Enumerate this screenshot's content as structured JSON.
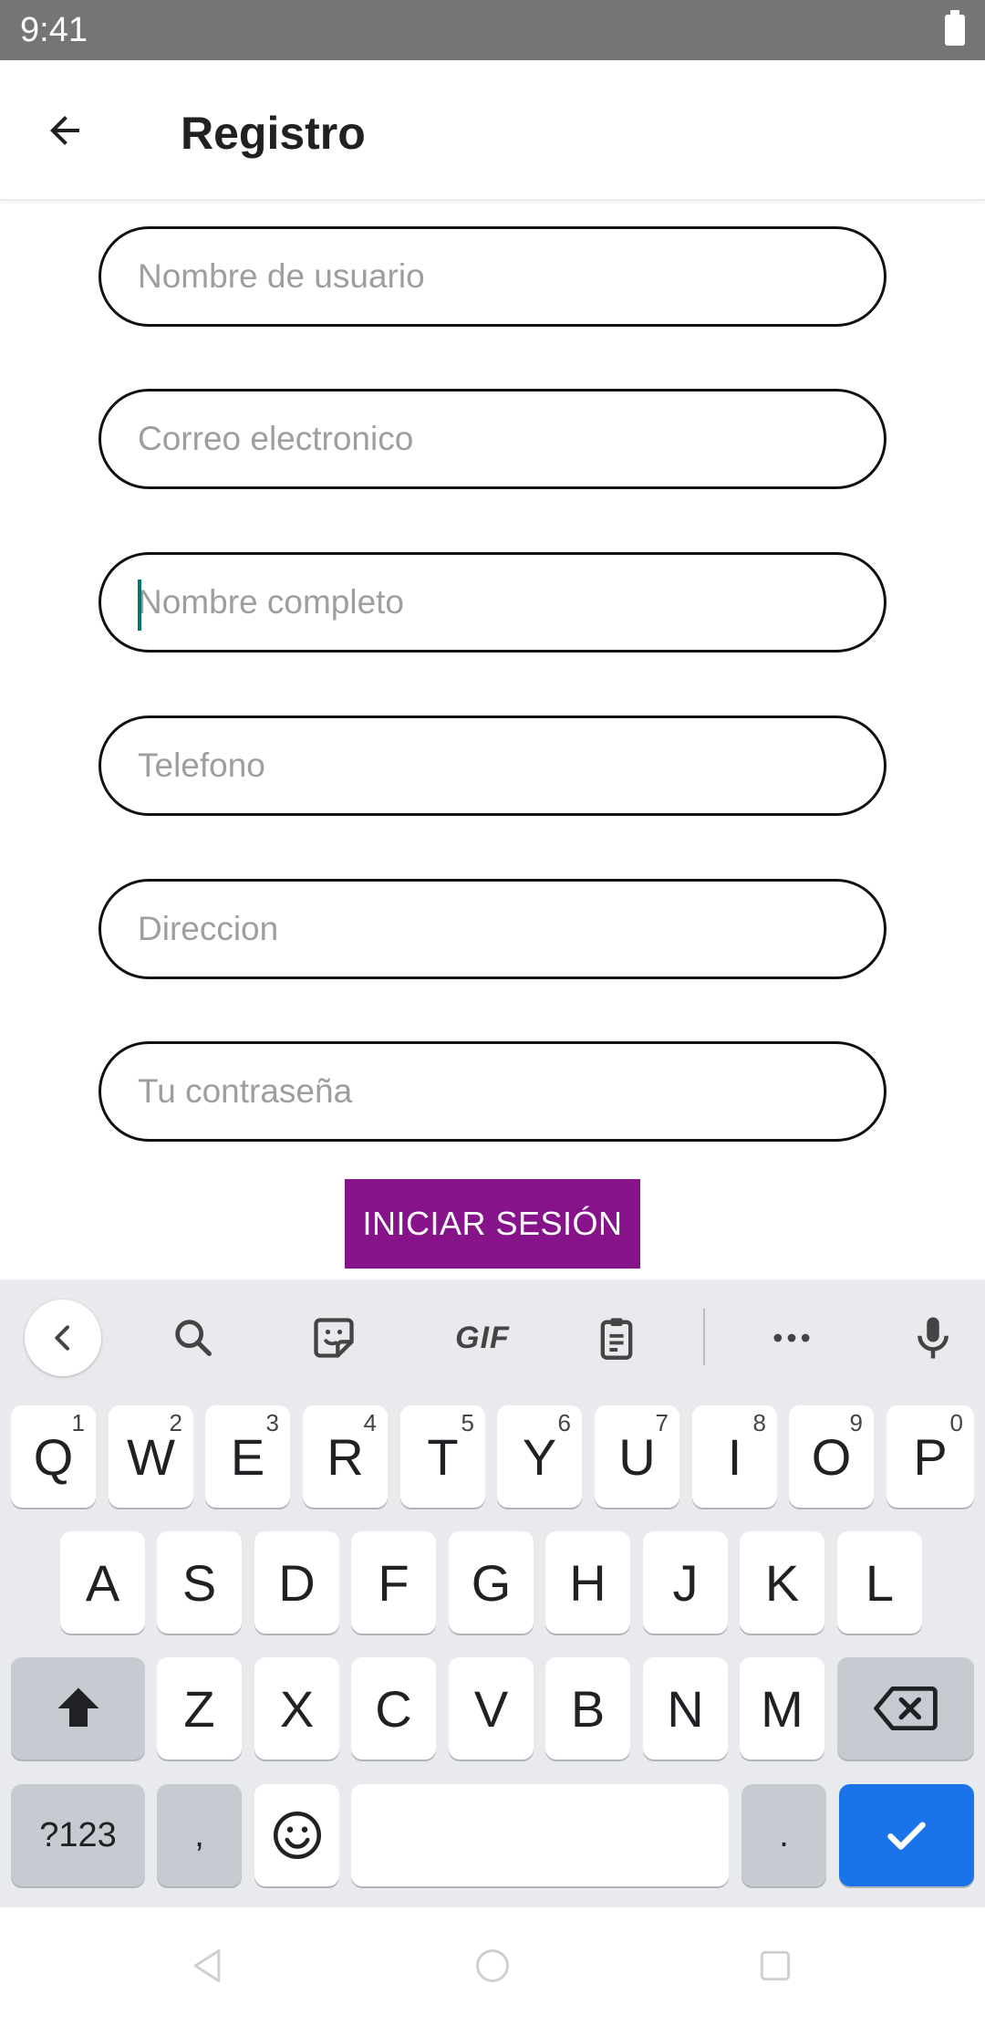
{
  "status_bar": {
    "time": "9:41"
  },
  "app_bar": {
    "title": "Registro"
  },
  "form": {
    "fields": [
      {
        "placeholder": "Nombre de usuario",
        "value": ""
      },
      {
        "placeholder": "Correo electronico",
        "value": ""
      },
      {
        "placeholder": "Nombre completo",
        "value": "",
        "focused": true
      },
      {
        "placeholder": "Telefono",
        "value": ""
      },
      {
        "placeholder": "Direccion",
        "value": ""
      },
      {
        "placeholder": "Tu contraseña",
        "value": ""
      }
    ],
    "submit_label": "INICIAR SESIÓN",
    "submit_color": "#86138a",
    "cursor_color": "#00796b"
  },
  "keyboard": {
    "toolbar": {
      "gif_label": "GIF",
      "icons": [
        "chevron-left-icon",
        "search-icon",
        "sticker-icon",
        "gif-icon",
        "clipboard-icon",
        "more-icon",
        "microphone-icon"
      ]
    },
    "row1": [
      {
        "label": "Q",
        "hint": "1"
      },
      {
        "label": "W",
        "hint": "2"
      },
      {
        "label": "E",
        "hint": "3"
      },
      {
        "label": "R",
        "hint": "4"
      },
      {
        "label": "T",
        "hint": "5"
      },
      {
        "label": "Y",
        "hint": "6"
      },
      {
        "label": "U",
        "hint": "7"
      },
      {
        "label": "I",
        "hint": "8"
      },
      {
        "label": "O",
        "hint": "9"
      },
      {
        "label": "P",
        "hint": "0"
      }
    ],
    "row2": [
      "A",
      "S",
      "D",
      "F",
      "G",
      "H",
      "J",
      "K",
      "L"
    ],
    "row3": [
      "Z",
      "X",
      "C",
      "V",
      "B",
      "N",
      "M"
    ],
    "bottom": {
      "symbols_label": "?123",
      "comma_label": ",",
      "period_label": "."
    },
    "enter_color": "#1a73e8"
  }
}
